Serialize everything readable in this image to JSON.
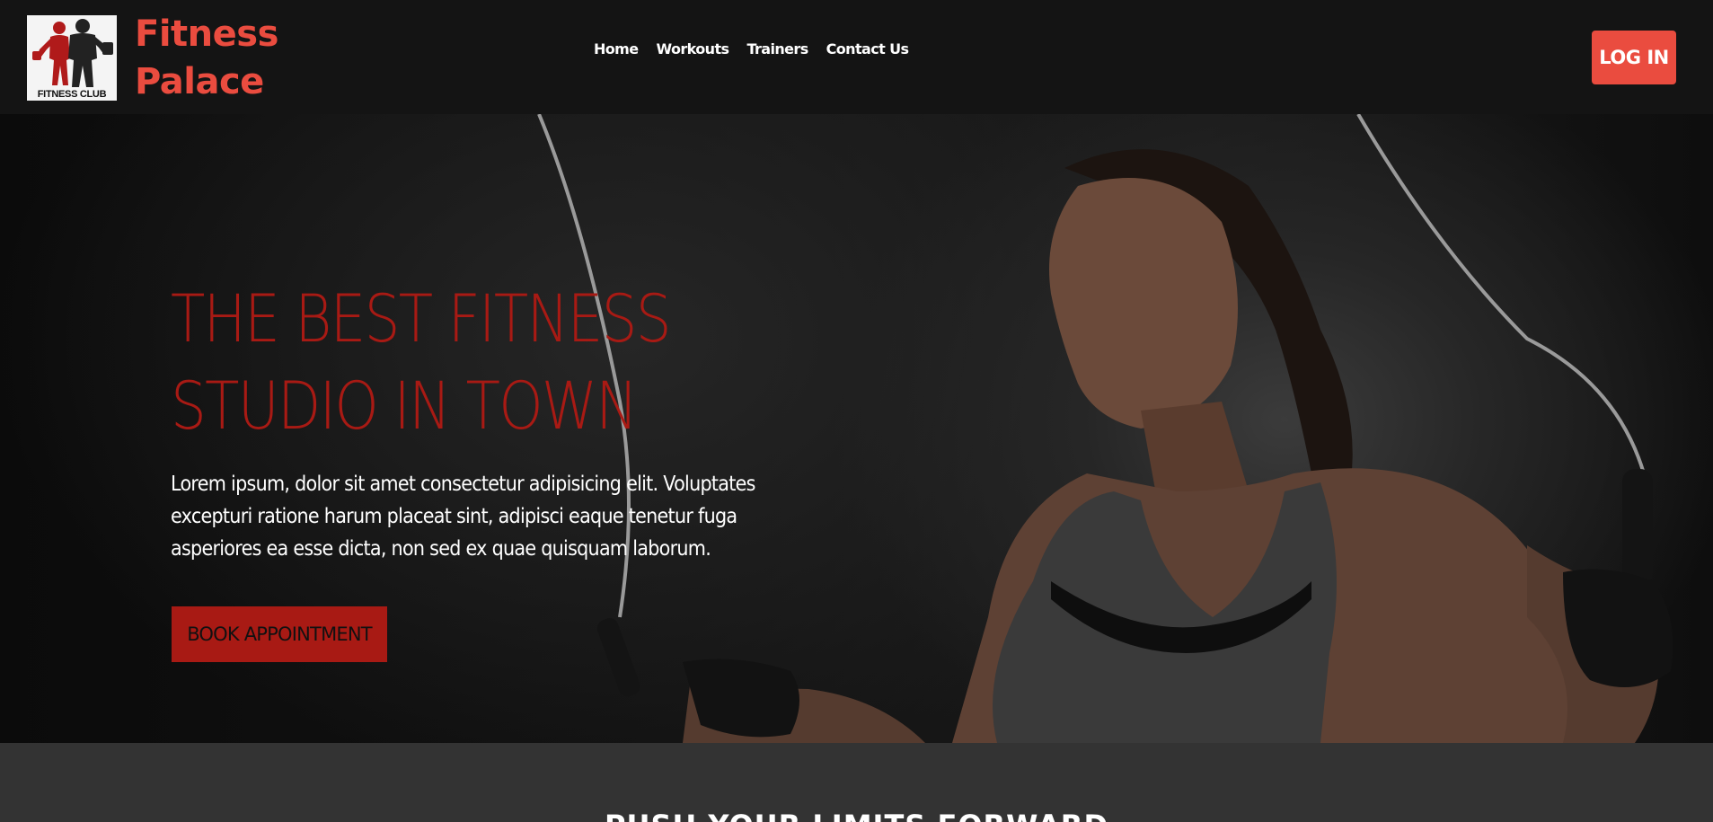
{
  "header": {
    "logo_caption": "FITNESS CLUB",
    "brand_line1": "Fitness",
    "brand_line2": "Palace",
    "nav": [
      {
        "label": "Home"
      },
      {
        "label": "Workouts"
      },
      {
        "label": "Trainers"
      },
      {
        "label": "Contact Us"
      }
    ],
    "login_label": "LOG IN"
  },
  "hero": {
    "title_line1": "THE BEST FITNESS",
    "title_line2": "STUDIO IN TOWN",
    "text": "Lorem ipsum, dolor sit amet consectetur adipisicing elit. Voluptates excepturi ratione harum placeat sint, adipisci eaque tenetur fuga asperiores ea esse dicta, non sed ex quae quisquam laborum.",
    "cta_label": "BOOK APPOINTMENT"
  },
  "section2": {
    "title": "PUSH YOUR LIMITS FORWARD"
  },
  "colors": {
    "brand": "#ea4c3f",
    "accent_dark": "#a81a14",
    "header_bg": "#141414",
    "section_bg": "#333333"
  },
  "icons": {
    "logo": "fitness-club-logo-icon"
  }
}
